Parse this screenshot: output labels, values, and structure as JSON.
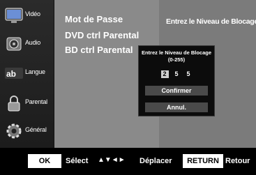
{
  "sidebar": {
    "items": [
      {
        "label": "Vidéo",
        "icon": "video-icon"
      },
      {
        "label": "Audio",
        "icon": "speaker-icon"
      },
      {
        "label": "Langue",
        "icon": "language-icon"
      },
      {
        "label": "Parental",
        "icon": "lock-icon"
      },
      {
        "label": "Général",
        "icon": "gear-icon"
      }
    ]
  },
  "main": {
    "menu": [
      "Mot de Passe",
      "DVD ctrl Parental",
      "BD ctrl Parental"
    ],
    "prompt": "Entrez le Niveau de BlocageB"
  },
  "dialog": {
    "title_line1": "Entrez le Niveau de Blocage",
    "title_line2": "(0-255)",
    "digits": [
      "2",
      "5",
      "5"
    ],
    "confirm_label": "Confirmer",
    "cancel_label": "Annul."
  },
  "bottom": {
    "ok_key": "OK",
    "select_label": "Sélect",
    "arrows": "▲▼◄►",
    "move_label": "Déplacer",
    "return_key": "RETURN",
    "return_label": "Retour"
  }
}
